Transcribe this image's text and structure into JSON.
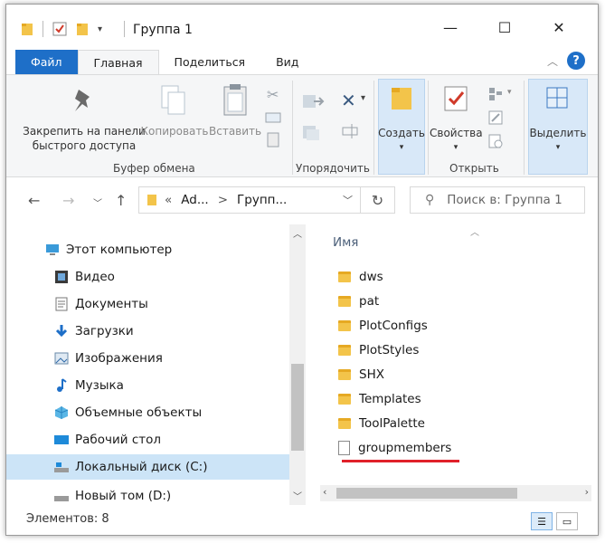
{
  "window": {
    "title": "Группа 1",
    "controls": {
      "minimize": "—",
      "maximize": "☐",
      "close": "✕"
    }
  },
  "ribbon_tabs": [
    {
      "label": "Файл",
      "kind": "file"
    },
    {
      "label": "Главная",
      "kind": "active"
    },
    {
      "label": "Поделиться",
      "kind": "normal"
    },
    {
      "label": "Вид",
      "kind": "normal"
    }
  ],
  "ribbon": {
    "pin_label_1": "Закрепить на панели",
    "pin_label_2": "быстрого доступа",
    "copy": "Копировать",
    "paste": "Вставить",
    "clipboard_group": "Буфер обмена",
    "organize_group": "Упорядочить",
    "create": "Создать",
    "properties": "Свойства",
    "open_group": "Открыть",
    "select": "Выделить"
  },
  "address": {
    "chevrons": "«",
    "crumb1": "Ad...",
    "arrow": ">",
    "crumb2": "Групп...",
    "search_placeholder": "Поиск в: Группа 1"
  },
  "nav_tree": [
    {
      "label": "Этот компьютер",
      "icon": "computer-icon",
      "selected": false
    },
    {
      "label": "Видео",
      "icon": "video-icon",
      "selected": false
    },
    {
      "label": "Документы",
      "icon": "documents-icon",
      "selected": false
    },
    {
      "label": "Загрузки",
      "icon": "downloads-icon",
      "selected": false
    },
    {
      "label": "Изображения",
      "icon": "pictures-icon",
      "selected": false
    },
    {
      "label": "Музыка",
      "icon": "music-icon",
      "selected": false
    },
    {
      "label": "Объемные объекты",
      "icon": "3d-objects-icon",
      "selected": false
    },
    {
      "label": "Рабочий стол",
      "icon": "desktop-icon",
      "selected": false
    },
    {
      "label": "Локальный диск (C:)",
      "icon": "drive-icon",
      "selected": true
    },
    {
      "label": "Новый том (D:)",
      "icon": "drive-icon",
      "selected": false
    }
  ],
  "content": {
    "column_header": "Имя",
    "files": [
      {
        "name": "dws",
        "type": "folder"
      },
      {
        "name": "pat",
        "type": "folder"
      },
      {
        "name": "PlotConfigs",
        "type": "folder"
      },
      {
        "name": "PlotStyles",
        "type": "folder"
      },
      {
        "name": "SHX",
        "type": "folder"
      },
      {
        "name": "Templates",
        "type": "folder"
      },
      {
        "name": "ToolPalette",
        "type": "folder"
      },
      {
        "name": "groupmembers",
        "type": "file"
      }
    ]
  },
  "status": {
    "items_count": "Элементов: 8"
  },
  "colors": {
    "accent": "#1e6fc8",
    "selection": "#cce4f7",
    "folder": "#f3c44a",
    "underline": "#e0202a"
  }
}
